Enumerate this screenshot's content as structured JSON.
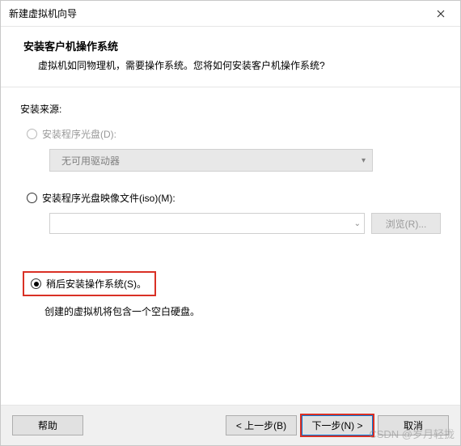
{
  "window": {
    "title": "新建虚拟机向导"
  },
  "header": {
    "title": "安装客户机操作系统",
    "subtitle": "虚拟机如同物理机，需要操作系统。您将如何安装客户机操作系统?"
  },
  "content": {
    "source_label": "安装来源:",
    "opt_disc": "安装程序光盘(D):",
    "dropdown_value": "无可用驱动器",
    "opt_iso": "安装程序光盘映像文件(iso)(M):",
    "browse_label": "浏览(R)...",
    "opt_later": "稍后安装操作系统(S)。",
    "hint": "创建的虚拟机将包含一个空白硬盘。"
  },
  "footer": {
    "help": "帮助",
    "back": "< 上一步(B)",
    "next": "下一步(N) >",
    "cancel": "取消"
  },
  "watermark": "CSDN @岁月轻拢"
}
